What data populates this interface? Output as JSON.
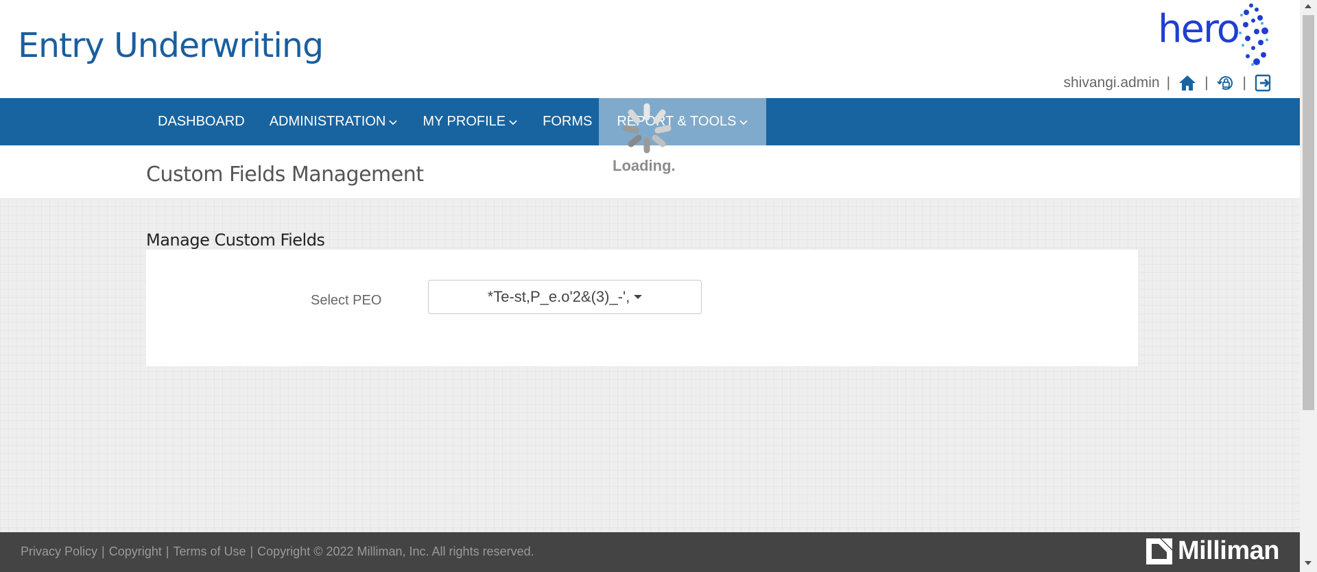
{
  "header": {
    "title": "Entry Underwriting",
    "logo_text": "hero",
    "username": "shivangi.admin",
    "separator": "|",
    "icons": [
      "home-icon",
      "lock-reset-icon",
      "logout-icon"
    ]
  },
  "nav": {
    "items": [
      {
        "label": "DASHBOARD"
      },
      {
        "label": "ADMINISTRATION"
      },
      {
        "label": "MY PROFILE"
      },
      {
        "label": "FORMS"
      },
      {
        "label": "REPORT & TOOLS"
      }
    ]
  },
  "page": {
    "title": "Custom Fields Management",
    "section_title": "Manage Custom Fields",
    "select_label": "Select PEO",
    "select_value": "*Te-st,P_e.o'2&(3)_-',"
  },
  "loading": {
    "text": "Loading."
  },
  "footer": {
    "links": [
      "Privacy Policy",
      "Copyright",
      "Terms of Use"
    ],
    "copyright": "Copyright © 2022 Milliman, Inc. All rights reserved.",
    "separator": "|",
    "brand": "Milliman"
  },
  "colors": {
    "primary": "#1864a0",
    "title_blue": "#1a5f9e",
    "footer_bg": "#444444",
    "logo_blue": "#1f3fd1"
  }
}
